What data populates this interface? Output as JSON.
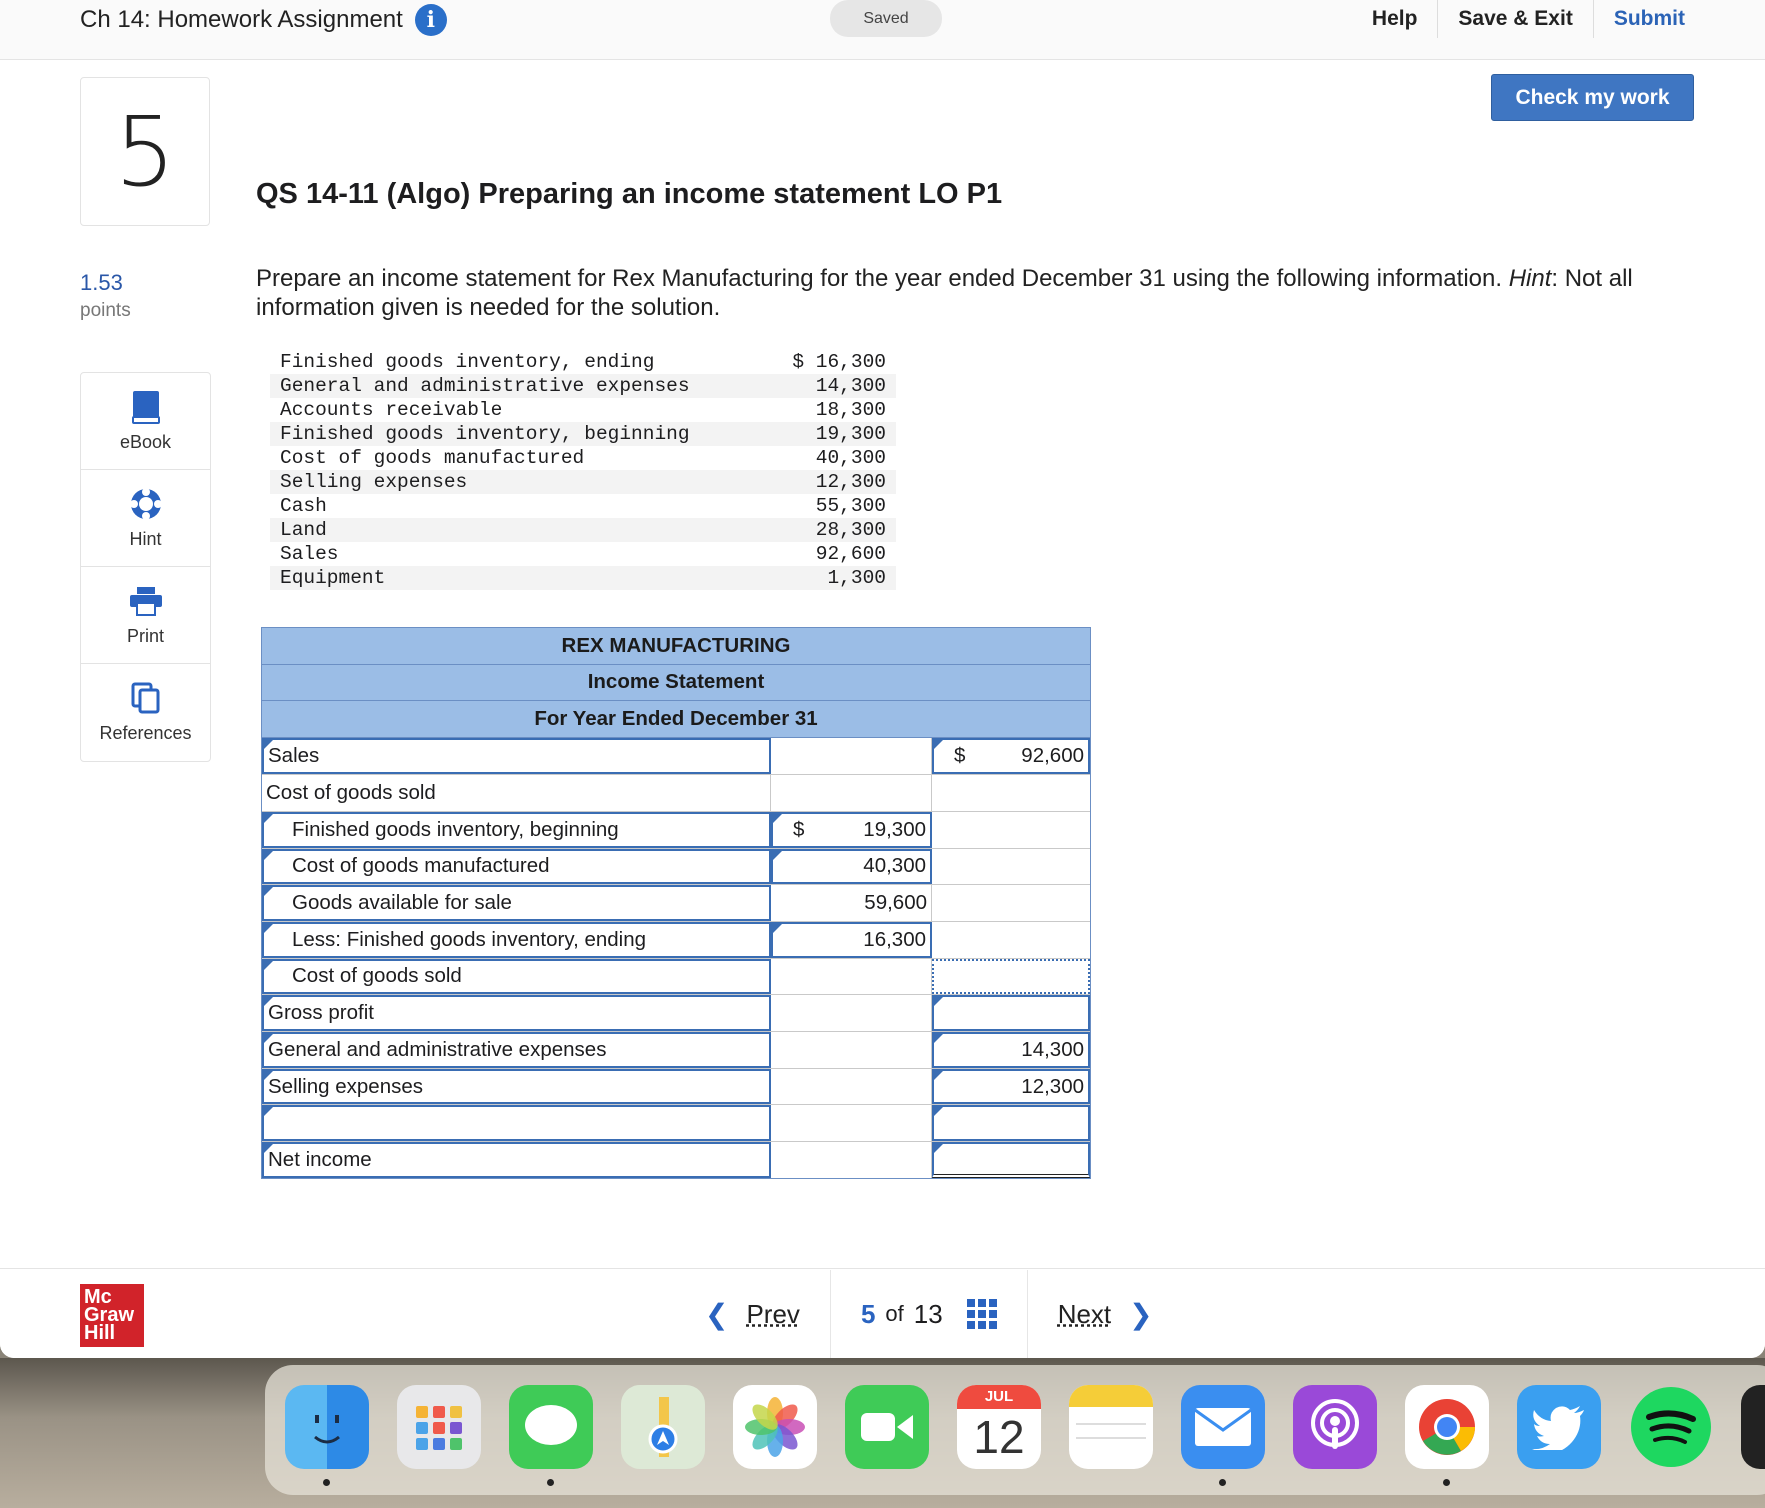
{
  "header": {
    "assignment_title": "Ch 14: Homework Assignment",
    "saved": "Saved",
    "help": "Help",
    "save_exit": "Save & Exit",
    "submit": "Submit",
    "check_my_work": "Check my work"
  },
  "question": {
    "number": "5",
    "points_value": "1.53",
    "points_label": "points",
    "title": "QS 14-11 (Algo) Preparing an income statement LO P1",
    "prompt_a": "Prepare an income statement for Rex Manufacturing for the year ended December 31 using the following information. ",
    "prompt_hint": "Hint",
    "prompt_b": ": Not all information given is needed for the solution."
  },
  "tools": [
    {
      "label": "eBook",
      "icon": "book-icon"
    },
    {
      "label": "Hint",
      "icon": "lifebuoy-icon"
    },
    {
      "label": "Print",
      "icon": "printer-icon"
    },
    {
      "label": "References",
      "icon": "copy-icon"
    }
  ],
  "given_data": [
    {
      "label": "Finished goods inventory, ending",
      "value": "$ 16,300"
    },
    {
      "label": "General and administrative expenses",
      "value": "14,300"
    },
    {
      "label": "Accounts receivable",
      "value": "18,300"
    },
    {
      "label": "Finished goods inventory, beginning",
      "value": "19,300"
    },
    {
      "label": "Cost of goods manufactured",
      "value": "40,300"
    },
    {
      "label": "Selling expenses",
      "value": "12,300"
    },
    {
      "label": "Cash",
      "value": "55,300"
    },
    {
      "label": "Land",
      "value": "28,300"
    },
    {
      "label": "Sales",
      "value": "92,600"
    },
    {
      "label": "Equipment",
      "value": "1,300"
    }
  ],
  "statement": {
    "company": "REX MANUFACTURING",
    "name": "Income Statement",
    "period": "For Year Ended December 31",
    "rows": [
      {
        "label": "Sales",
        "mid": "",
        "right": "92,600",
        "right_dollar": "$"
      },
      {
        "label": "Cost of goods sold",
        "mid": "",
        "right": ""
      },
      {
        "label": "Finished goods inventory, beginning",
        "mid": "19,300",
        "mid_dollar": "$",
        "right": ""
      },
      {
        "label": "Cost of goods manufactured",
        "mid": "40,300",
        "right": ""
      },
      {
        "label": "Goods available for sale",
        "mid": "59,600",
        "right": ""
      },
      {
        "label": "Less: Finished goods inventory, ending",
        "mid": "16,300",
        "right": ""
      },
      {
        "label": "Cost of goods sold",
        "mid": "",
        "right": ""
      },
      {
        "label": "Gross profit",
        "mid": "",
        "right": ""
      },
      {
        "label": "General and administrative expenses",
        "mid": "",
        "right": "14,300"
      },
      {
        "label": "Selling expenses",
        "mid": "",
        "right": "12,300"
      },
      {
        "label": "",
        "mid": "",
        "right": ""
      },
      {
        "label": "Net income",
        "mid": "",
        "right": ""
      }
    ]
  },
  "footer": {
    "logo_line1": "Mc",
    "logo_line2": "Graw",
    "logo_line3": "Hill",
    "prev": "Prev",
    "current": "5",
    "of": "of",
    "total": "13",
    "next": "Next"
  },
  "dock": {
    "calendar_month": "JUL",
    "calendar_day": "12",
    "apps": [
      "finder-icon",
      "launchpad-icon",
      "messages-icon",
      "maps-icon",
      "photos-icon",
      "facetime-icon",
      "calendar-icon",
      "notes-icon",
      "mail-icon",
      "podcasts-icon",
      "chrome-icon",
      "twitter-icon",
      "spotify-icon"
    ]
  }
}
